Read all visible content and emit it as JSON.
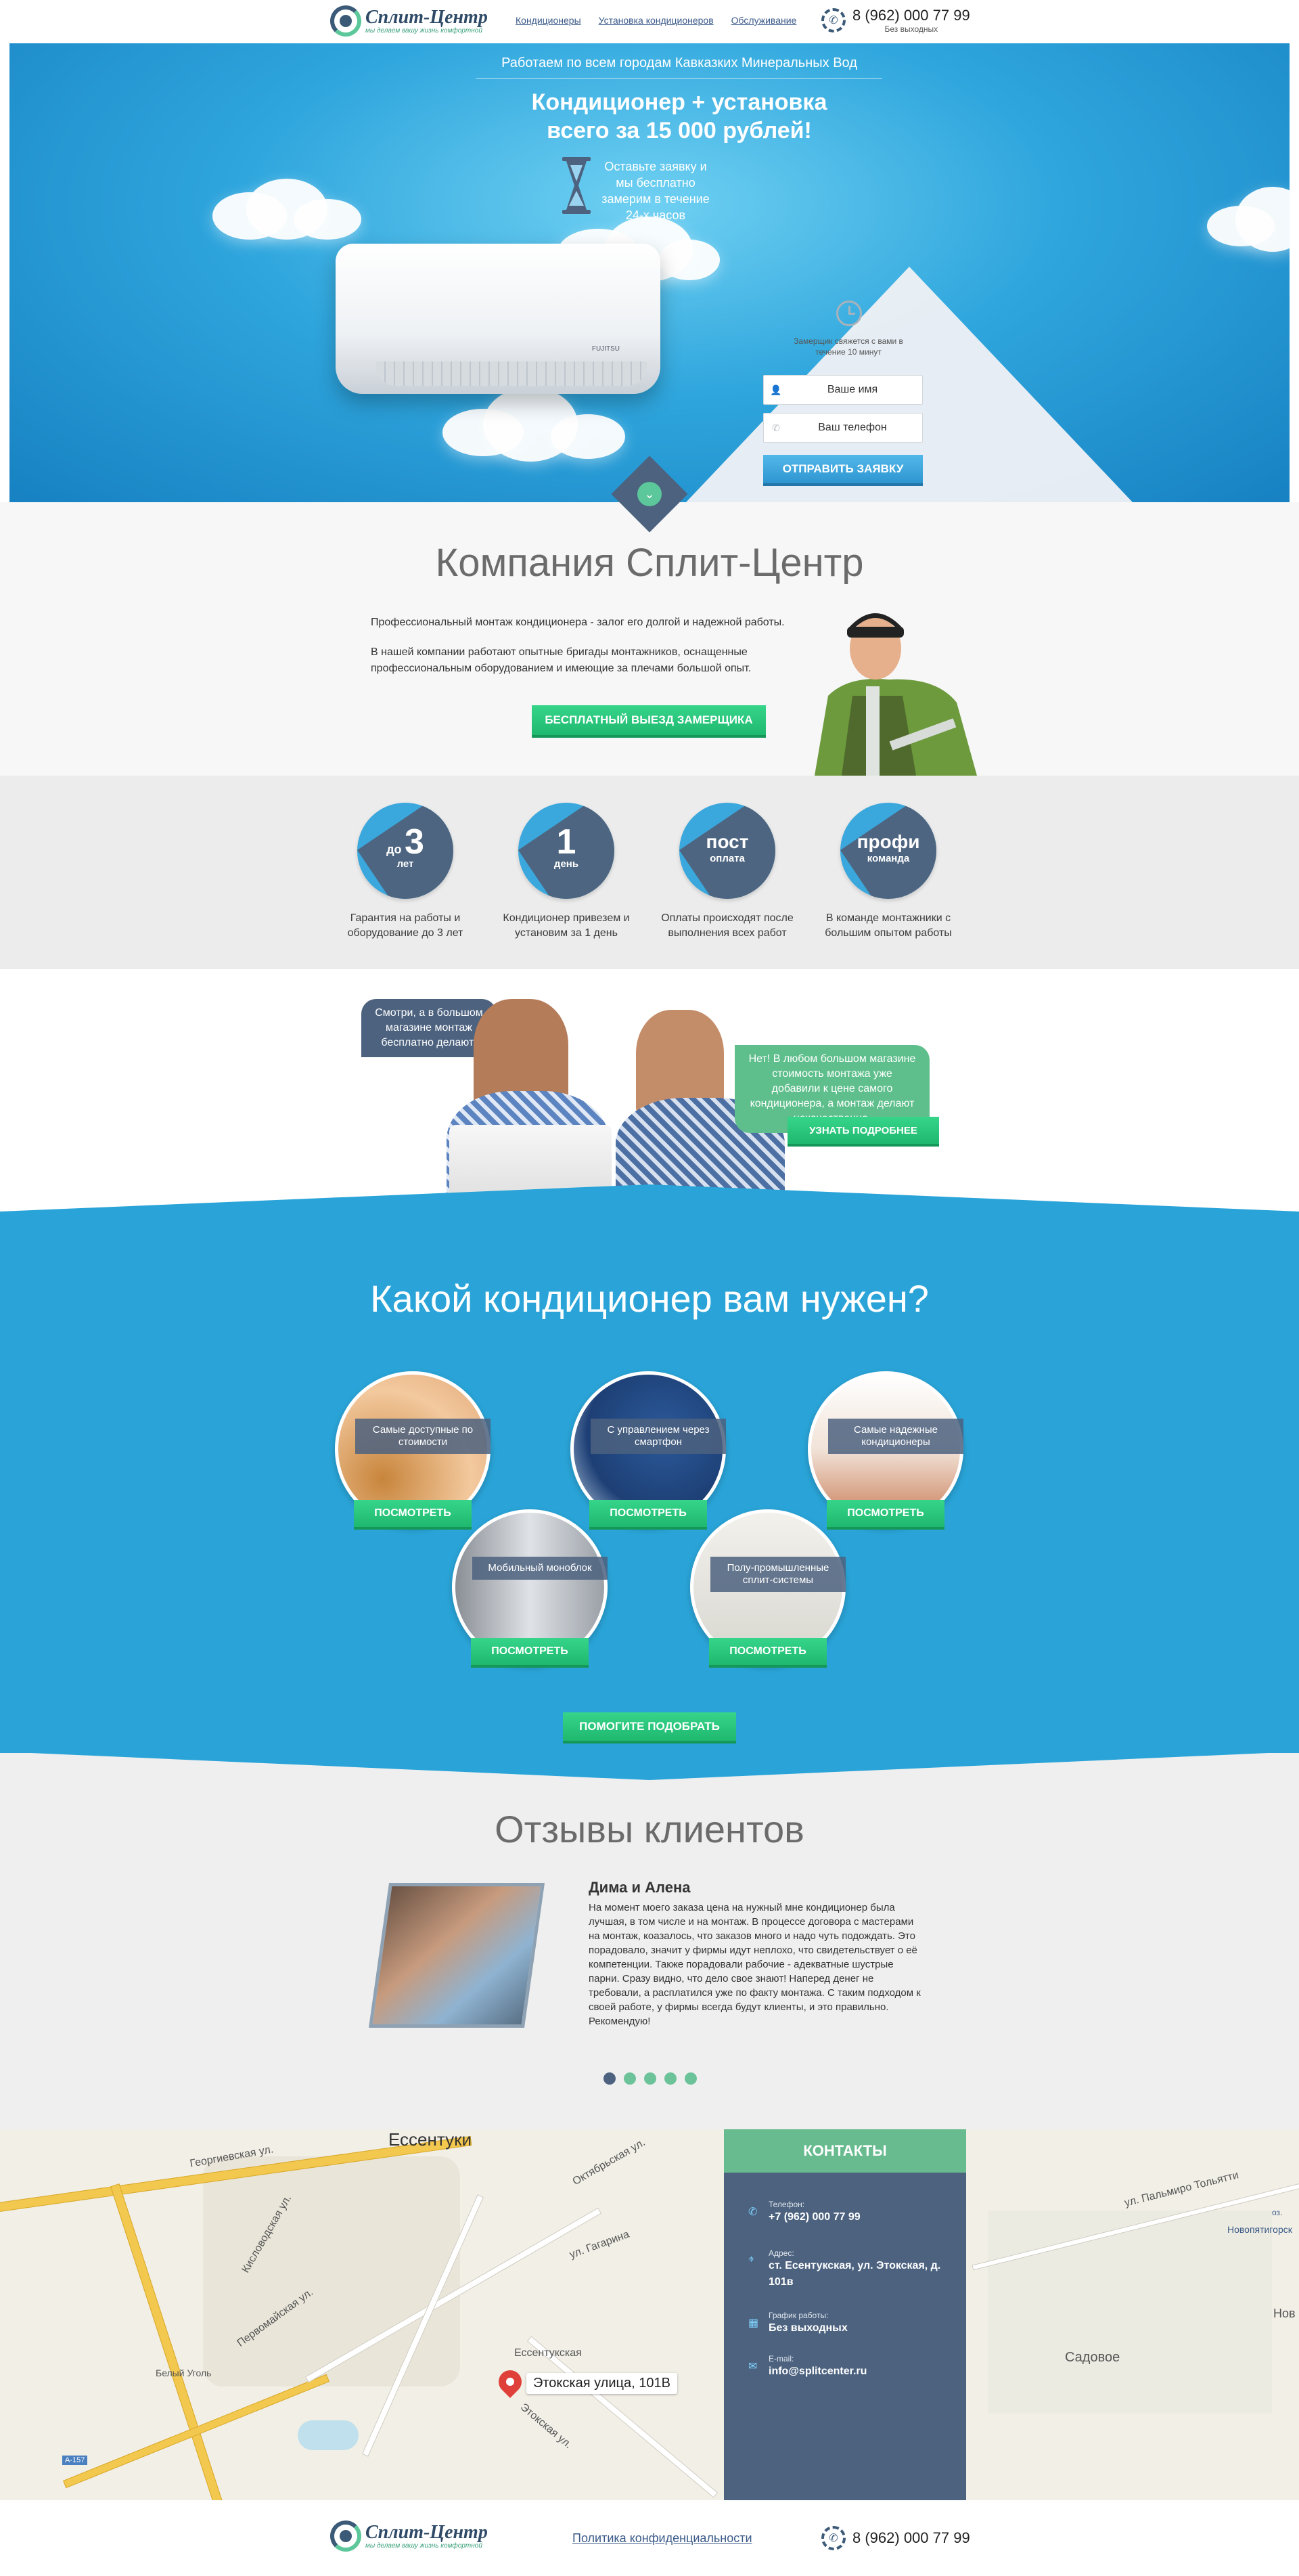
{
  "brand": {
    "name": "Сплит-Центр",
    "tagline": "мы делаем вашу жизнь комфортной"
  },
  "header": {
    "nav": [
      "Кондиционеры",
      "Установка кондиционеров",
      "Обслуживание"
    ],
    "phone": "8 (962) 000 77 99",
    "phone_sub": "Без выходных"
  },
  "hero": {
    "top_text": "Работаем по всем городам Кавказких Минеральных Вод",
    "title_line1": "Кондиционер + установка",
    "title_line2": "всего за 15 000 рублей!",
    "note": "Оставьте заявку и мы бесплатно замерим в течение 24-х часов",
    "ac_brand": "FUJITSU",
    "form": {
      "note": "Замерщик свяжется с вами в течение 10 минут",
      "name_placeholder": "Ваше имя",
      "phone_placeholder": "Ваш телефон",
      "submit_label": "ОТПРАВИТЬ ЗАЯВКУ"
    }
  },
  "company": {
    "title": "Компания Сплит-Центр",
    "p1": "Профессиональный монтаж кондиционера - залог его долгой и надежной работы.",
    "p2": "В нашей компании работают опытные бригады монтажников, оснащенные профессиональным оборудованием и имеющие за плечами большой опыт.",
    "button": "БЕСПЛАТНЫЙ ВЫЕЗД ЗАМЕРЩИКА"
  },
  "advantages": [
    {
      "pre": "до",
      "big": "3",
      "sub": "лет",
      "text": "Гарантия на работы и оборудование до 3 лет"
    },
    {
      "pre": "",
      "big": "1",
      "sub": "день",
      "text": "Кондиционер привезем и установим за 1 день"
    },
    {
      "pre": "",
      "big": "пост",
      "sub": "оплата",
      "text": "Оплаты происходят после выполнения всех работ"
    },
    {
      "pre": "",
      "big": "профи",
      "sub": "команда",
      "text": "В команде монтажники с большим опытом работы"
    }
  ],
  "dialog": {
    "left": "Смотри, а в большом магазине монтаж бесплатно делают!",
    "right": "Нет! В любом большом магазине стоимость монтажа уже добавили к цене самого кондиционера, а монтаж делают некачественно.",
    "button": "УЗНАТЬ ПОДРОБНЕЕ"
  },
  "selector": {
    "title": "Какой кондиционер вам нужен?",
    "types": [
      {
        "label": "Самые доступные по стоимости",
        "button": "ПОСМОТРЕТЬ",
        "tint": "#d9a06a"
      },
      {
        "label": "С управлением через смартфон",
        "button": "ПОСМОТРЕТЬ",
        "tint": "#3b6ea8"
      },
      {
        "label": "Самые надежные кондиционеры",
        "button": "ПОСМОТРЕТЬ",
        "tint": "#f1d6c3"
      },
      {
        "label": "Мобильный моноблок",
        "button": "ПОСМОТРЕТЬ",
        "tint": "#c7cbd0"
      },
      {
        "label": "Полу-промышленные сплит-системы",
        "button": "ПОСМОТРЕТЬ",
        "tint": "#e6e6e0"
      }
    ],
    "help_button": "ПОМОГИТЕ ПОДОБРАТЬ"
  },
  "reviews": {
    "title": "Отзывы клиентов",
    "name": "Дима и Алена",
    "text": "На момент моего заказа цена на нужный мне кондиционер была лучшая, в том числе и на монтаж. В процессе договора с мастерами на монтаж, коазалось, что заказов много и надо чуть подождать. Это порадовало, значит у фирмы идут неплохо, что свидетельствует о её компетенции. Также порадовали рабочие - адекватные шустрые парни. Сразу видно, что дело свое знают! Наперед денег не требовали, а расплатился уже по факту монтажа. С таким подходом к своей работе, у фирмы всегда будут клиенты, и это правильно. Рекомендую!",
    "dots": 5
  },
  "map": {
    "city": "Ессентуки",
    "pin_label": "Этокская улица, 101В",
    "streets": [
      "Кисловодская ул.",
      "Первомайская ул.",
      "ул. Гагарина",
      "Этокская ул.",
      "Октябрьская ул.",
      "Ессентукская",
      "Георгиевская ул.",
      "ул. Пальмиро Тольятти"
    ],
    "places": [
      "Белый Уголь",
      "Садовое",
      "Новопятигорск",
      "Нов",
      "А-157",
      "оз."
    ]
  },
  "contacts": {
    "title": "КОНТАКТЫ",
    "items": [
      {
        "icon": "phone-icon",
        "label": "Телефон:",
        "value": "+7 (962) 000 77 99"
      },
      {
        "icon": "location-icon",
        "label": "Адрес:",
        "value": "ст. Есентукская, ул. Этокская, д. 101в"
      },
      {
        "icon": "calendar-icon",
        "label": "График работы:",
        "value": "Без выходных"
      },
      {
        "icon": "mail-icon",
        "label": "E-mail:",
        "value": "info@splitcenter.ru"
      }
    ]
  },
  "footer": {
    "link": "Политика конфиденциальности",
    "phone": "8 (962) 000 77 99"
  },
  "colors": {
    "accent_green": "#27c47a",
    "navy": "#4c627f",
    "blue": "#2aa4d8"
  }
}
